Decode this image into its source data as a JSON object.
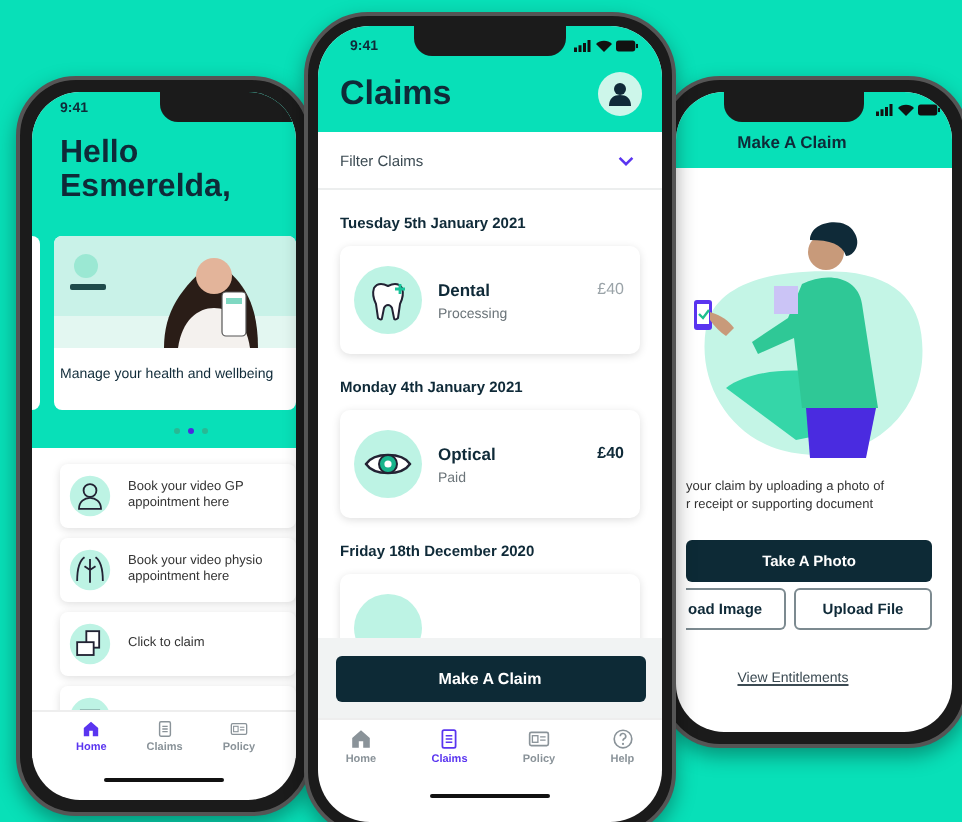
{
  "home_screen": {
    "status_time": "9:41",
    "greeting": "Hello Esmerelda,",
    "banner": {
      "kind": "picture",
      "caption": "Manage your health and wellbeing"
    },
    "carousel_dots": [
      {
        "selected": false
      },
      {
        "selected": true
      },
      {
        "selected": false
      }
    ],
    "actions": [
      {
        "kind": "doctor",
        "label": "Book your video GP appointment here"
      },
      {
        "kind": "physio",
        "label": "Book your video physio appointment here"
      },
      {
        "kind": "claim",
        "label": "Click to claim"
      },
      {
        "kind": "partial"
      }
    ],
    "tabs": [
      {
        "kind": "home",
        "label": "Home",
        "selected": true
      },
      {
        "kind": "claims",
        "label": "Claims",
        "selected": false
      },
      {
        "kind": "policy",
        "label": "Policy",
        "selected": false
      }
    ]
  },
  "claims_screen": {
    "status_time": "9:41",
    "title": "Claims",
    "filter": {
      "label": "Filter Claims",
      "expanded": false
    },
    "groups": [
      {
        "date": "Tuesday 5th January 2021",
        "claims": [
          {
            "kind": "dental",
            "name": "Dental",
            "status": "Processing",
            "amount": "£40",
            "settled": false
          }
        ]
      },
      {
        "date": "Monday 4th January 2021",
        "claims": [
          {
            "kind": "optical",
            "name": "Optical",
            "status": "Paid",
            "amount": "£40",
            "settled": true
          }
        ]
      },
      {
        "date": "Friday 18th December 2020",
        "claims": [
          {
            "kind": "partial"
          }
        ]
      }
    ],
    "button": "Make A Claim",
    "tabs": [
      {
        "kind": "home",
        "label": "Home",
        "selected": false
      },
      {
        "kind": "claims",
        "label": "Claims",
        "selected": true
      },
      {
        "kind": "policy",
        "label": "Policy",
        "selected": false
      },
      {
        "kind": "help",
        "label": "Help",
        "selected": false
      }
    ]
  },
  "make_claim_screen": {
    "title": "Make A Claim",
    "illustration": {
      "kind": "person"
    },
    "description": [
      "your claim by uploading a photo of",
      "r receipt or supporting document"
    ],
    "primary_button": "Take A Photo",
    "secondary_buttons": [
      "oad Image",
      "Upload File"
    ],
    "link": "View Entitlements"
  }
}
